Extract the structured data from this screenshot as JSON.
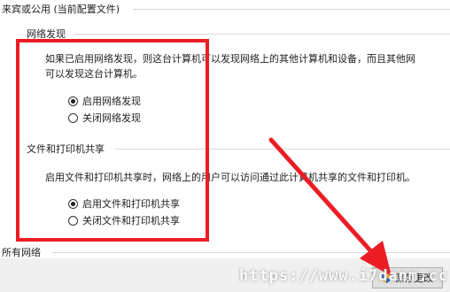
{
  "header": {
    "profile_title": "来宾或公用 (当前配置文件)"
  },
  "network_discovery": {
    "title": "网络发现",
    "description_line1": "如果已启用网络发现，则这台计算机可以发现网络上的其他计算机和设备，而且其他网",
    "description_line2": "可以发现这台计算机。",
    "options": [
      {
        "label": "启用网络发现",
        "selected": true
      },
      {
        "label": "关闭网络发现",
        "selected": false
      }
    ]
  },
  "file_sharing": {
    "title": "文件和打印机共享",
    "description": "启用文件和打印机共享时，网络上的用户可以访问通过此计算机共享的文件和打印机。",
    "options": [
      {
        "label": "启用文件和打印机共享",
        "selected": true
      },
      {
        "label": "关闭文件和打印机共享",
        "selected": false
      }
    ]
  },
  "all_networks": {
    "title": "所有网络"
  },
  "footer": {
    "save_button_label": "保存更改",
    "save_icon": "uac-shield-icon"
  },
  "watermark": {
    "text": "https://www.i7danm.cc"
  },
  "colors": {
    "annotation_red": "#ec1c24",
    "background": "#ffffff",
    "footer_bg": "#f0f0f0"
  }
}
